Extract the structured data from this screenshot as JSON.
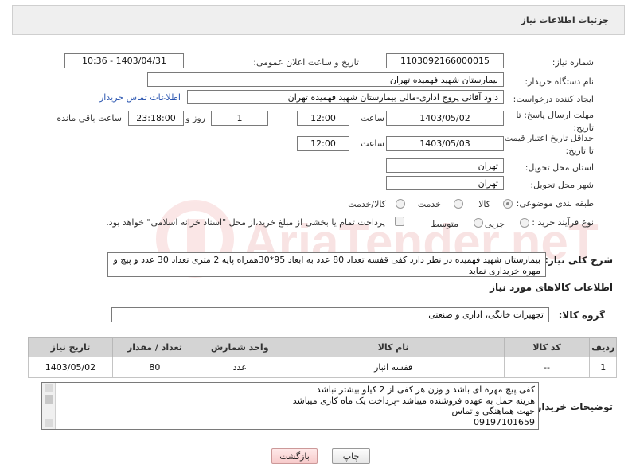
{
  "header": {
    "title": "جزئیات اطلاعات نیاز"
  },
  "watermark": {
    "text": "AriaTender.neT"
  },
  "form": {
    "need_number": {
      "label": "شماره نیاز:",
      "value": "1103092166000015"
    },
    "announce_datetime": {
      "label": "تاریخ و ساعت اعلان عمومی:",
      "value": "1403/04/31 - 10:36"
    },
    "buyer_org": {
      "label": "نام دستگاه خریدار:",
      "value": "بیمارستان شهید فهمیده تهران"
    },
    "creator": {
      "label": "ایجاد کننده درخواست:",
      "value": "داود آقائی پروج اداری-مالی بیمارستان شهید فهمیده تهران",
      "link": "اطلاعات تماس خریدار"
    },
    "reply_deadline": {
      "label": "مهلت ارسال پاسخ: تا تاریخ:",
      "date": "1403/05/02",
      "time_label": "ساعت",
      "time": "12:00",
      "days": "1",
      "days_label": "روز و",
      "remaining": "23:18:00",
      "remaining_label": "ساعت باقی مانده"
    },
    "price_validity": {
      "label": "حداقل تاریخ اعتبار قیمت: تا تاریخ:",
      "date": "1403/05/03",
      "time_label": "ساعت",
      "time": "12:00"
    },
    "delivery_province": {
      "label": "استان محل تحویل:",
      "value": "تهران"
    },
    "delivery_city": {
      "label": "شهر محل تحویل:",
      "value": "تهران"
    },
    "category": {
      "label": "طبقه بندی موضوعی:",
      "options": [
        "کالا",
        "خدمت",
        "کالا/خدمت"
      ],
      "selected": "کالا"
    },
    "purchase_type": {
      "label": "نوع فرآیند خرید :",
      "options": [
        "جزیی",
        "متوسط"
      ],
      "checkbox_text": "پرداخت تمام یا بخشی از مبلغ خرید،از محل \"اسناد خزانه اسلامی\" خواهد بود."
    },
    "description": {
      "label": "شرح کلی نیاز:",
      "value": "بیمارستان شهید فهمیده در نظر دارد  کفی قفسه تعداد 80 عدد به ابعاد 95*30همراه پایه 2 متری تعداد 30 عدد و پیچ و مهره خریداری نماید"
    }
  },
  "goods_section": {
    "title": "اطلاعات کالاهای مورد نیاز",
    "group_label": "گروه کالا:",
    "group_value": "تجهیزات خانگی، اداری و صنعتی"
  },
  "table": {
    "headers": [
      "ردیف",
      "کد کالا",
      "نام کالا",
      "واحد شمارش",
      "تعداد / مقدار",
      "تاریخ نیاز"
    ],
    "rows": [
      [
        "1",
        "--",
        "قفسه انبار",
        "عدد",
        "80",
        "1403/05/02"
      ]
    ]
  },
  "buyer_notes": {
    "label": "توضیحات خریدار:",
    "lines": [
      "کفی پیچ مهره ای باشد و  وزن هر کفی از 2 کیلو بیشتر نباشد",
      "هزینه حمل به عهده فروشنده میباشد -پرداخت یک ماه کاری میباشد",
      "جهت هماهنگی و تماس",
      "09197101659"
    ]
  },
  "buttons": {
    "print": "چاپ",
    "back": "بازگشت"
  }
}
